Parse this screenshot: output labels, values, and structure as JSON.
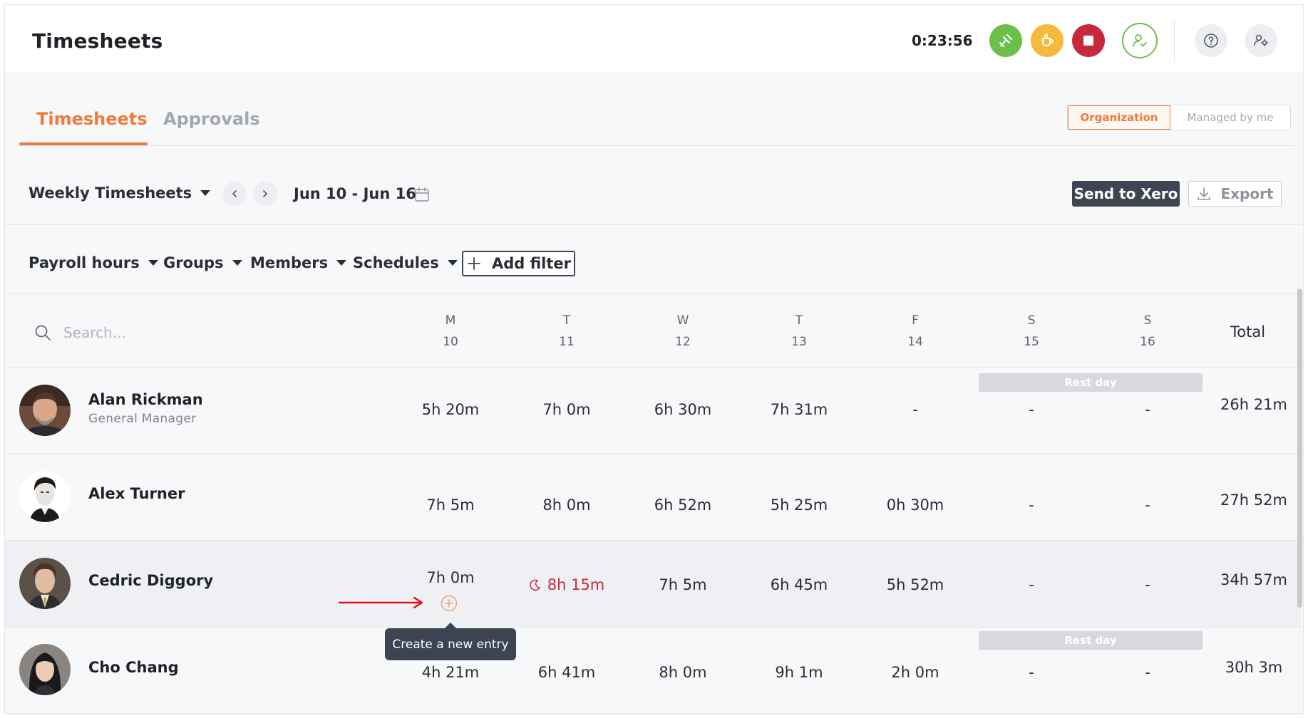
{
  "app": {
    "title": "Timesheets",
    "timer": "0:23:56"
  },
  "header_actions": {
    "start_label": "Start timer",
    "break_label": "Break",
    "stop_label": "Stop",
    "colors": {
      "start": "#6cc04a",
      "break": "#f6b93b",
      "stop": "#c8283e",
      "profile_outline": "#6cc04a"
    }
  },
  "tabs": [
    {
      "label": "Timesheets",
      "active": true
    },
    {
      "label": "Approvals",
      "active": false
    }
  ],
  "scope_toggle": {
    "options": [
      "Organization",
      "Managed by me"
    ],
    "selected": "Organization"
  },
  "toolbar": {
    "view_label": "Weekly Timesheets",
    "date_range": "Jun 10 - Jun 16",
    "send_label": "Send to Xero",
    "export_label": "Export"
  },
  "filters": {
    "items": [
      "Payroll hours",
      "Groups",
      "Members",
      "Schedules"
    ],
    "add_label": "Add filter"
  },
  "table": {
    "search_placeholder": "Search...",
    "days": [
      {
        "letter": "M",
        "num": "10"
      },
      {
        "letter": "T",
        "num": "11"
      },
      {
        "letter": "W",
        "num": "12"
      },
      {
        "letter": "T",
        "num": "13"
      },
      {
        "letter": "F",
        "num": "14"
      },
      {
        "letter": "S",
        "num": "15"
      },
      {
        "letter": "S",
        "num": "16"
      }
    ],
    "total_label": "Total",
    "rest_day_label": "Rest day",
    "rows": [
      {
        "name": "Alan Rickman",
        "role": "General Manager",
        "hours": [
          "5h 20m",
          "7h 0m",
          "6h 30m",
          "7h 31m",
          "-",
          "-",
          "-"
        ],
        "total": "26h 21m"
      },
      {
        "name": "Alex Turner",
        "role": "",
        "hours": [
          "7h 5m",
          "8h 0m",
          "6h 52m",
          "5h 25m",
          "0h 30m",
          "-",
          "-"
        ],
        "total": "27h 52m"
      },
      {
        "name": "Cedric Diggory",
        "role": "",
        "hours": [
          "7h 0m",
          "8h 15m",
          "7h 5m",
          "6h 45m",
          "5h 52m",
          "-",
          "-"
        ],
        "total": "34h 57m"
      },
      {
        "name": "Cho Chang",
        "role": "",
        "hours": [
          "4h 21m",
          "6h 41m",
          "8h 0m",
          "9h 1m",
          "2h 0m",
          "-",
          "-"
        ],
        "total": "30h 3m"
      }
    ],
    "tooltip": "Create a new entry",
    "highlight_color": "#c8283e",
    "accent_color": "#ef7a3c"
  }
}
